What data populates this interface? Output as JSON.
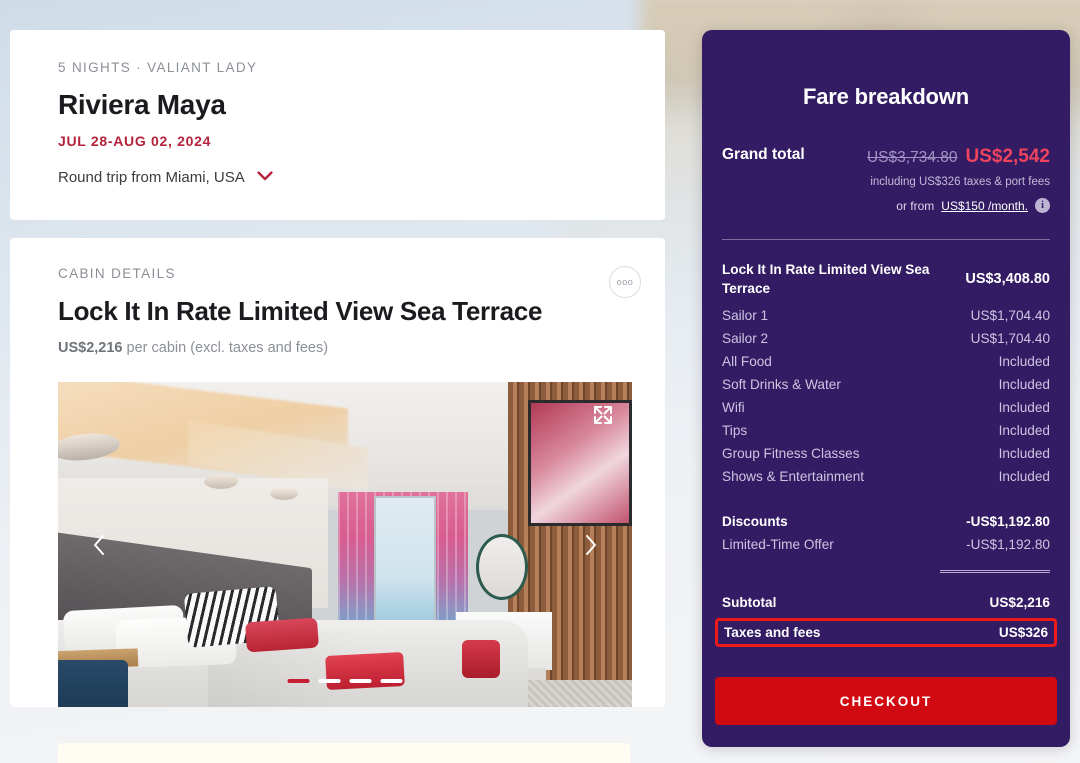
{
  "voyage": {
    "eyebrow": "5 NIGHTS · VALIANT LADY",
    "title": "Riviera Maya",
    "dates": "JUL 28-AUG 02, 2024",
    "roundtrip": "Round trip from Miami, USA",
    "chevron_icon": "chevron-down-icon"
  },
  "cabin": {
    "eyebrow": "CABIN DETAILS",
    "title": "Lock It In Rate Limited View Sea Terrace",
    "price": "US$2,216",
    "price_suffix": " per cabin (excl. taxes and fees)",
    "more_options_icon": "ooo",
    "expand_icon": "expand-icon",
    "prev_icon": "chevron-left-icon",
    "next_icon": "chevron-right-icon",
    "slides": 4,
    "active_slide": 1
  },
  "fare": {
    "title": "Fare breakdown",
    "grand_total_label": "Grand total",
    "grand_total_original": "US$3,734.80",
    "grand_total_current": "US$2,542",
    "grand_total_note": "including US$326 taxes & port fees",
    "monthly_prefix": "or from",
    "monthly_amount": "US$150 /month.",
    "info_icon": "i",
    "items": [
      {
        "label": "Lock It In Rate Limited View Sea Terrace",
        "value": "US$3,408.80",
        "emphasis": true
      },
      {
        "label": "Sailor 1",
        "value": "US$1,704.40",
        "emphasis": false
      },
      {
        "label": "Sailor 2",
        "value": "US$1,704.40",
        "emphasis": false
      },
      {
        "label": "All Food",
        "value": "Included",
        "emphasis": false
      },
      {
        "label": "Soft Drinks & Water",
        "value": "Included",
        "emphasis": false
      },
      {
        "label": "Wifi",
        "value": "Included",
        "emphasis": false
      },
      {
        "label": "Tips",
        "value": "Included",
        "emphasis": false
      },
      {
        "label": "Group Fitness Classes",
        "value": "Included",
        "emphasis": false
      },
      {
        "label": "Shows & Entertainment",
        "value": "Included",
        "emphasis": false
      }
    ],
    "discounts": [
      {
        "label": "Discounts",
        "value": "-US$1,192.80",
        "emphasis": true
      },
      {
        "label": "Limited-Time Offer",
        "value": "-US$1,192.80",
        "emphasis": false
      }
    ],
    "totals": [
      {
        "label": "Subtotal",
        "value": "US$2,216"
      }
    ],
    "taxes": {
      "label": "Taxes and fees",
      "value": "US$326"
    },
    "checkout_label": "CHECKOUT"
  },
  "colors": {
    "panel_purple": "#331C63",
    "accent_red": "#D10A12",
    "date_red": "#B3243C",
    "price_pink": "#F0435D",
    "highlight_red": "#EF1A1A",
    "muted_lavender": "#CDC4E2"
  }
}
